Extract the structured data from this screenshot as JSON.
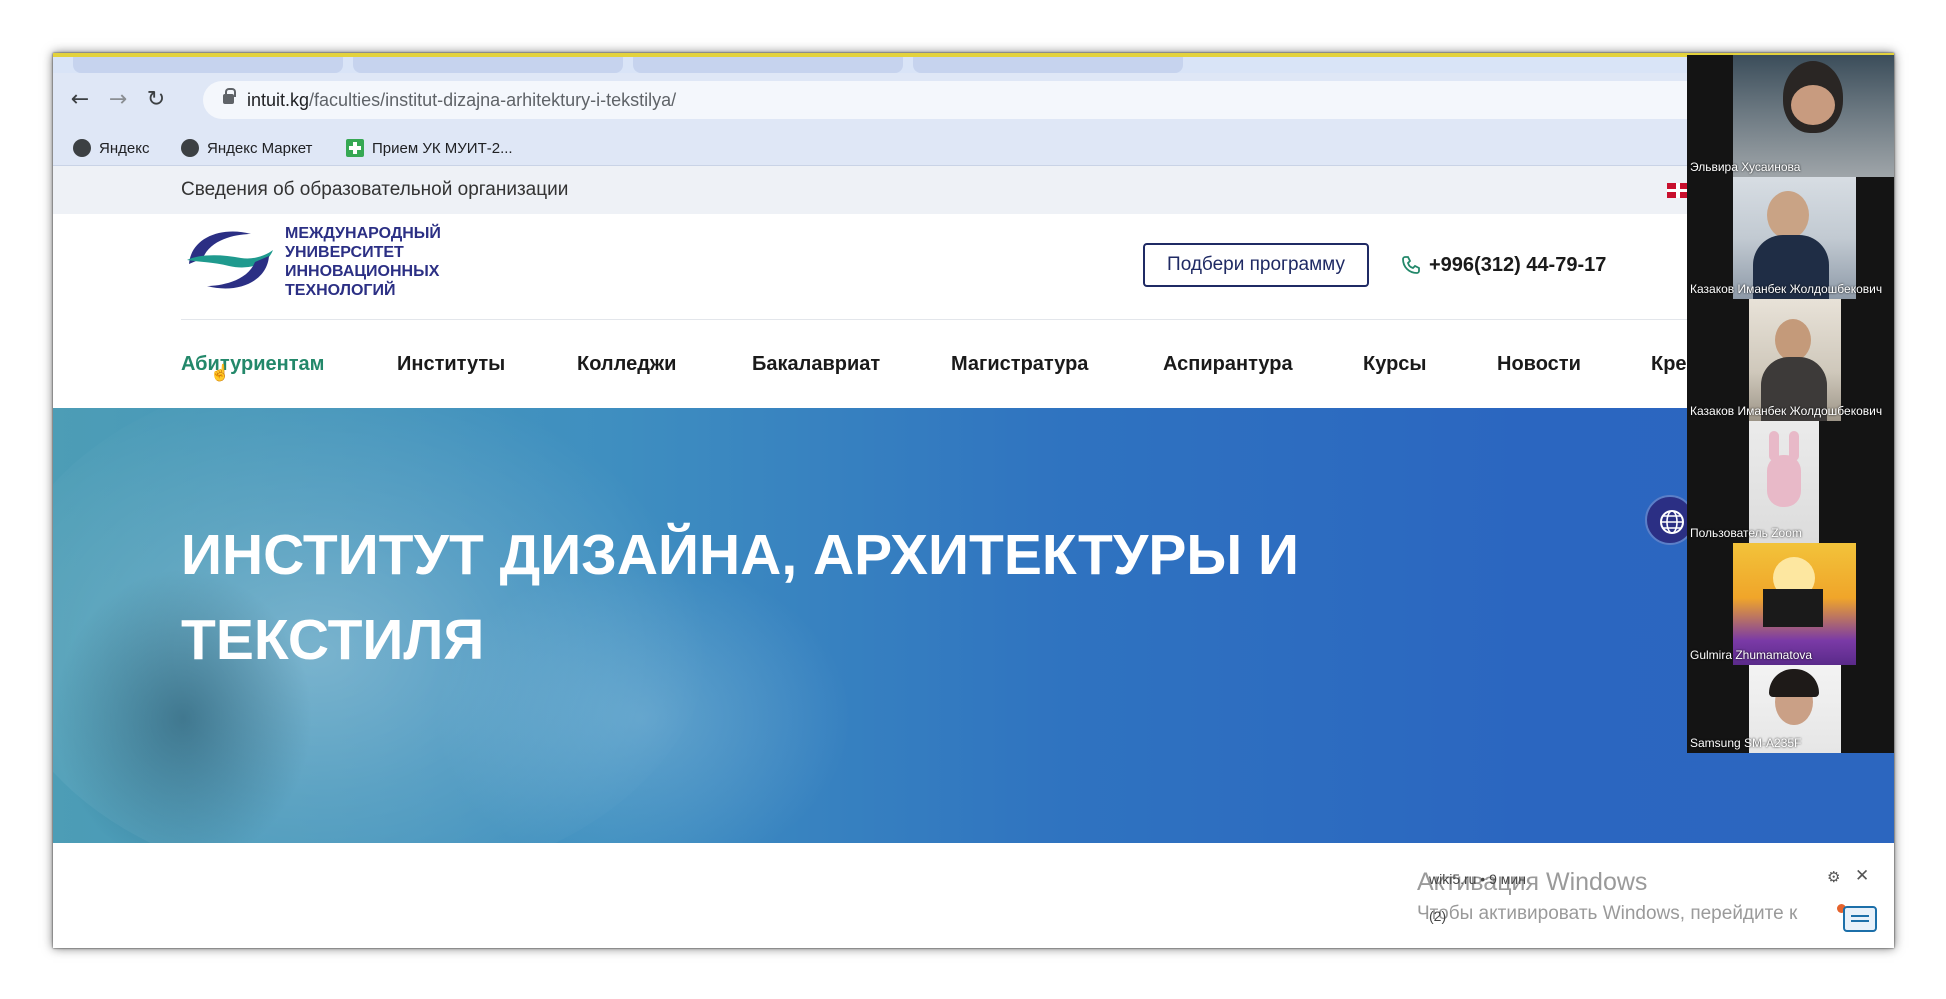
{
  "browser": {
    "nav_icons": [
      "back-arrow-icon",
      "forward-arrow-icon",
      "reload-icon"
    ],
    "url_host": "intuit.kg",
    "url_path": "/faculties/institut-dizajna-arhitektury-i-tekstilya/",
    "bookmarks": [
      {
        "label": "Яндекс",
        "icon": "yandex-icon"
      },
      {
        "label": "Яндекс Маркет",
        "icon": "yandex-market-icon"
      },
      {
        "label": "Прием УК МУИТ-2...",
        "icon": "plus-bookmark-icon"
      }
    ]
  },
  "site": {
    "top_info": "Сведения об образовательной организации",
    "logo_lines": [
      "МЕЖДУНАРОДНЫЙ",
      "УНИВЕРСИТЕТ",
      "ИННОВАЦИОННЫХ",
      "ТЕХНОЛОГИЙ"
    ],
    "program_button": "Подбери программу",
    "phone": "+996(312) 44-79-17",
    "nav": [
      "Абитуриентам",
      "Институты",
      "Колледжи",
      "Бакалавриат",
      "Магистратура",
      "Аспирантура",
      "Курсы",
      "Новости",
      "Кре"
    ],
    "hero_title_line1": "ИНСТИТУТ ДИЗАЙНА, АРХИТЕКТУРЫ И",
    "hero_title_line2": "ТЕКСТИЛЯ",
    "colors": {
      "accent_green": "#23886a",
      "brand_navy": "#2b2f84",
      "hero_blue": "#2c66bf"
    }
  },
  "overlay": {
    "watermark_title": "Активация Windows",
    "watermark_text": "Чтобы активировать Windows, перейдите к",
    "download_line": "wiki5.ru • 9 мин",
    "message_count": "(2)"
  },
  "zoom": {
    "participants": [
      {
        "name": "Эльвира Хусаинова"
      },
      {
        "name": "Казаков Иманбек Жолдошбекович"
      },
      {
        "name": "Казаков Иманбек Жолдошбекович"
      },
      {
        "name": "Пользователь Zoom"
      },
      {
        "name": "Gulmira Zhumamatova"
      },
      {
        "name": "Samsung SM-A235F"
      }
    ]
  }
}
